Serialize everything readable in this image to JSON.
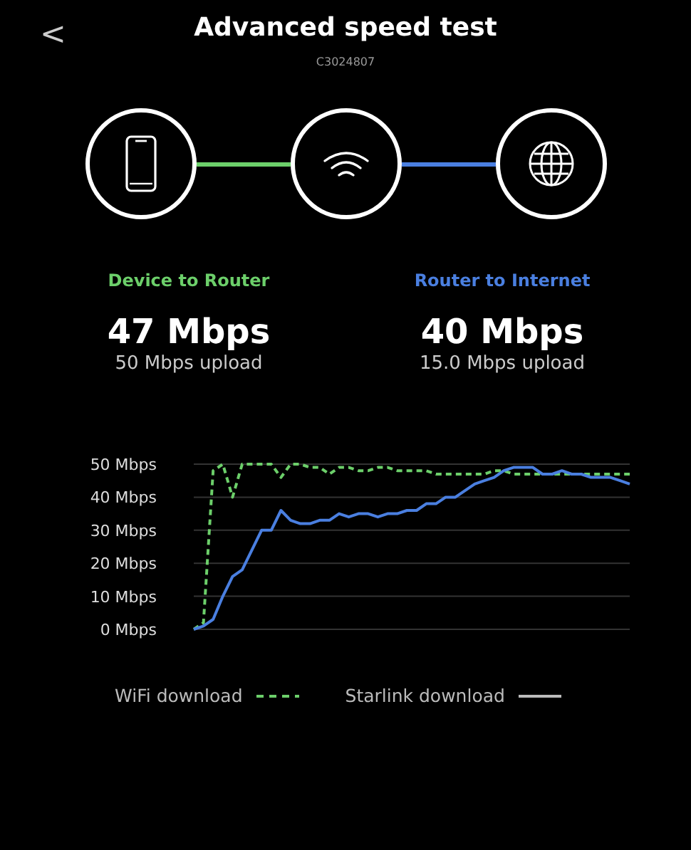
{
  "header": {
    "back": "<",
    "title": "Advanced speed test",
    "subtitle": "C3024807"
  },
  "path": [
    {
      "kind": "phone"
    },
    {
      "kind": "wifi"
    },
    {
      "kind": "globe"
    }
  ],
  "links": [
    {
      "color": "#6ccf6a"
    },
    {
      "color": "#4a7fe0"
    }
  ],
  "stats": [
    {
      "label": "Device to Router",
      "color": "#6ccf6a",
      "download": "47 Mbps",
      "upload": "50 Mbps upload"
    },
    {
      "label": "Router to Internet",
      "color": "#4a7fe0",
      "download": "40 Mbps",
      "upload": "15.0 Mbps upload"
    }
  ],
  "chart": {
    "chart_data": {
      "type": "line",
      "grid": true,
      "ylim": [
        0,
        50
      ],
      "yticks": [
        {
          "value": 0,
          "label": "0 Mbps"
        },
        {
          "value": 10,
          "label": "10 Mbps"
        },
        {
          "value": 20,
          "label": "20 Mbps"
        },
        {
          "value": 30,
          "label": "30 Mbps"
        },
        {
          "value": 40,
          "label": "40 Mbps"
        },
        {
          "value": 50,
          "label": "50 Mbps"
        }
      ],
      "series": [
        {
          "name": "WiFi download",
          "color": "#6ccf6a",
          "line_style": "dashed",
          "values": [
            0,
            2,
            48,
            50,
            40,
            50,
            50,
            50,
            50,
            46,
            50,
            50,
            49,
            49,
            47,
            49,
            49,
            48,
            48,
            49,
            49,
            48,
            48,
            48,
            48,
            47,
            47,
            47,
            47,
            47,
            47,
            48,
            48,
            47,
            47,
            47,
            47,
            47,
            47,
            47,
            47,
            47,
            47,
            47,
            47,
            47
          ]
        },
        {
          "name": "Starlink download",
          "color": "#4a7fe0",
          "line_style": "solid",
          "values": [
            0,
            1,
            3,
            10,
            16,
            18,
            24,
            30,
            30,
            36,
            33,
            32,
            32,
            33,
            33,
            35,
            34,
            35,
            35,
            34,
            35,
            35,
            36,
            36,
            38,
            38,
            40,
            40,
            42,
            44,
            45,
            46,
            48,
            49,
            49,
            49,
            47,
            47,
            48,
            47,
            47,
            46,
            46,
            46,
            45,
            44
          ]
        }
      ]
    }
  }
}
